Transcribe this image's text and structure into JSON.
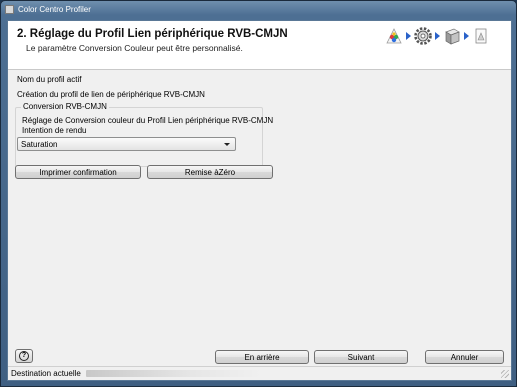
{
  "window": {
    "title": "Color Centro Profiler"
  },
  "header": {
    "step_title": "2. Réglage du Profil Lien périphérique RVB-CMJN",
    "step_subtitle": "Le paramètre Conversion Couleur peut être personnalisé."
  },
  "steps": [
    "palette-icon",
    "gear-icon",
    "printer-icon",
    "document-icon"
  ],
  "form": {
    "profile_name_label": "Nom du profil actif",
    "profile_name_value": "Création du profil de lien de périphérique RVB-CMJN",
    "group_title": "Conversion RVB-CMJN",
    "group_description": "Réglage de Conversion couleur du Profil Lien périphérique RVB-CMJN",
    "intent_label": "Intention de rendu",
    "intent_value": "Saturation"
  },
  "actions": {
    "print_label": "Imprimer confirmation",
    "reset_label": "Remise àZéro"
  },
  "footer": {
    "back_label": "En arrière",
    "next_label": "Suivant",
    "cancel_label": "Annuler",
    "help_glyph": "?"
  },
  "status": {
    "destination_label": "Destination actuelle"
  }
}
